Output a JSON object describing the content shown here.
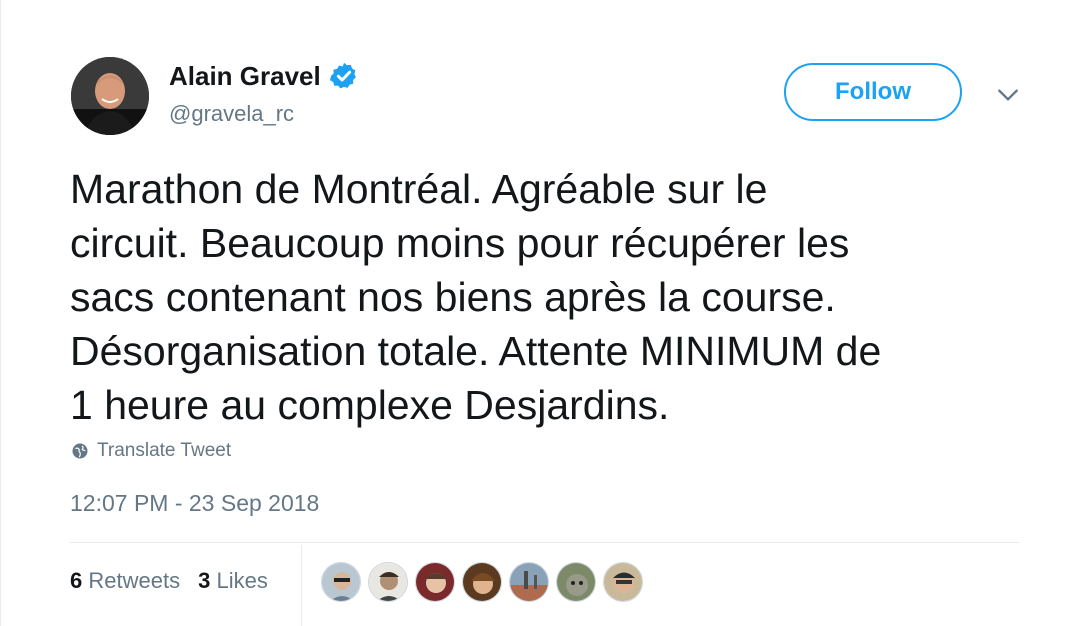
{
  "author": {
    "name": "Alain Gravel",
    "handle": "@gravela_rc",
    "verified": true
  },
  "actions": {
    "follow_label": "Follow",
    "more_icon": "chevron-down-icon"
  },
  "tweet": {
    "text": "Marathon de Montréal. Agréable sur le\ncircuit. Beaucoup moins pour récupérer les\nsacs contenant nos biens après la course.\nDésorganisation totale. Attente MINIMUM de\n1 heure au complexe Desjardins.",
    "translate_label": "Translate Tweet",
    "timestamp": "12:07 PM - 23 Sep 2018"
  },
  "stats": {
    "retweets_count": "6",
    "retweets_label": "Retweets",
    "likes_count": "3",
    "likes_label": "Likes"
  },
  "likers": [
    {
      "name": "liker-1"
    },
    {
      "name": "liker-2"
    },
    {
      "name": "liker-3"
    },
    {
      "name": "liker-4"
    },
    {
      "name": "liker-5"
    },
    {
      "name": "liker-6"
    },
    {
      "name": "liker-7"
    }
  ],
  "colors": {
    "accent": "#1da1f2",
    "text": "#14171a",
    "muted": "#657786",
    "border": "#e6ecf0"
  }
}
